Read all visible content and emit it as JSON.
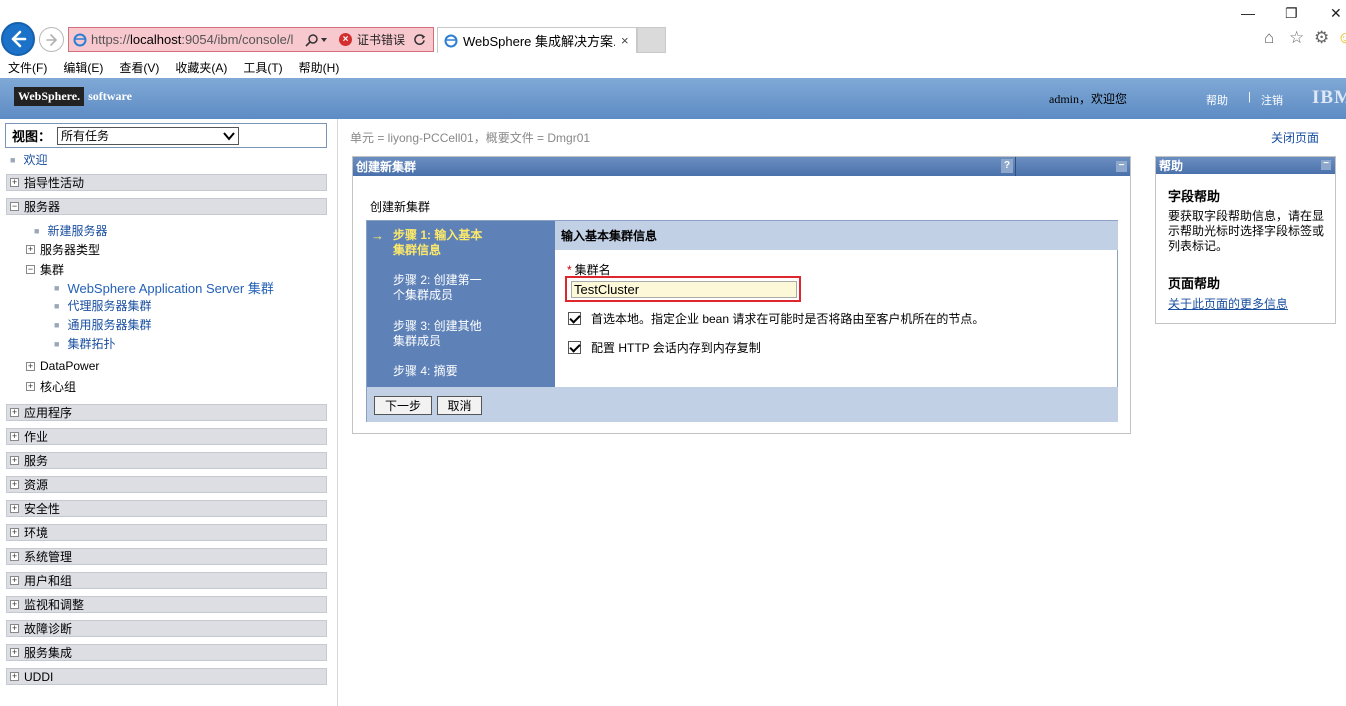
{
  "browser": {
    "url_prefix": "https://",
    "url_host": "localhost",
    "url_rest": ":9054/ibm/console/l",
    "cert_error": "证书错误",
    "tab_title": "WebSphere 集成解决方案...",
    "tab_close": "×",
    "menu": [
      "文件(F)",
      "编辑(E)",
      "查看(V)",
      "收藏夹(A)",
      "工具(T)",
      "帮助(H)"
    ],
    "win_min": "—",
    "win_restore": "❐",
    "win_close": "✕"
  },
  "header": {
    "logo_box": "WebSphere.",
    "logo_soft": "software",
    "welcome": "admin，欢迎您",
    "help_link": "帮助",
    "separator": "|",
    "logout_link": "注销",
    "ibm": "IBM"
  },
  "nav": {
    "view_label": "视图：",
    "view_value": "所有任务",
    "welcome": "欢迎",
    "guided": "指导性活动",
    "servers": "服务器",
    "new_server": "新建服务器",
    "server_types": "服务器类型",
    "clusters": "集群",
    "was_cluster": "WebSphere Application Server 集群",
    "proxy_cluster": "代理服务器集群",
    "generic_cluster": "通用服务器集群",
    "cluster_topology": "集群拓扑",
    "datapower": "DataPower",
    "core_group": "核心组",
    "categories": [
      "应用程序",
      "作业",
      "服务",
      "资源",
      "安全性",
      "环境",
      "系统管理",
      "用户和组",
      "监视和调整",
      "故障诊断",
      "服务集成",
      "UDDI"
    ]
  },
  "main": {
    "breadcrumb": "单元 = liyong-PCCell01，概要文件 = Dmgr01",
    "close_page": "关闭页面",
    "panel_title": "创建新集群",
    "panel_help": "?",
    "panel_min": "−",
    "subtitle": "创建新集群",
    "arrow": "→",
    "steps": [
      [
        "步骤 1: 输入基本",
        "集群信息"
      ],
      [
        "步骤 2: 创建第一",
        "个集群成员"
      ],
      [
        "步骤 3: 创建其他",
        "集群成员"
      ],
      [
        "步骤 4: 摘要"
      ]
    ],
    "wizard_title": "输入基本集群信息",
    "required_mark": "*",
    "field_label": "集群名",
    "cluster_name": "TestCluster",
    "prefer_local": "首选本地。指定企业 bean 请求在可能时是否将路由至客户机所在的节点。",
    "http_replication": "配置 HTTP 会话内存到内存复制",
    "next_button": "下一步",
    "cancel_button": "取消"
  },
  "help": {
    "title": "帮助",
    "min": "−",
    "field_help_title": "字段帮助",
    "field_help_text": "要获取字段帮助信息，请在显示帮助光标时选择字段标签或列表标记。",
    "page_help_title": "页面帮助",
    "page_help_link": "关于此页面的更多信息"
  }
}
